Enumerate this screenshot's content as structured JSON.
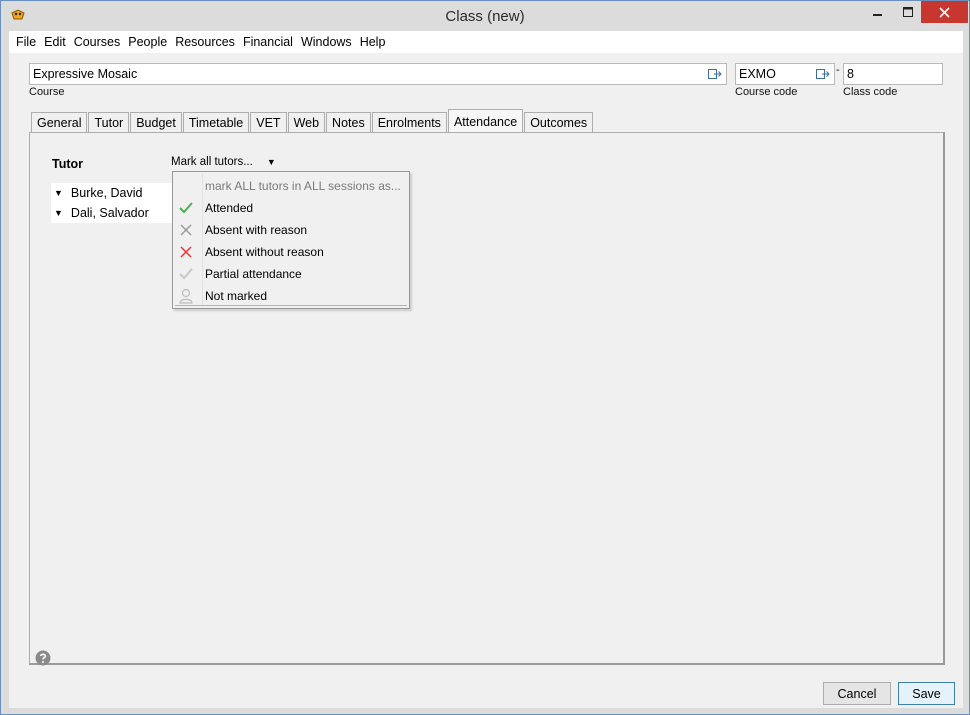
{
  "window": {
    "title": "Class (new)",
    "accent_close": "#c7372f"
  },
  "menu": [
    "File",
    "Edit",
    "Courses",
    "People",
    "Resources",
    "Financial",
    "Windows",
    "Help"
  ],
  "course": {
    "value": "Expressive Mosaic",
    "label": "Course"
  },
  "course_code": {
    "value": "EXMO",
    "label": "Course code"
  },
  "separator": "-",
  "class_code": {
    "value": "8",
    "label": "Class code"
  },
  "tabs": [
    "General",
    "Tutor",
    "Budget",
    "Timetable",
    "VET",
    "Web",
    "Notes",
    "Enrolments",
    "Attendance",
    "Outcomes"
  ],
  "active_tab": "Attendance",
  "attendance": {
    "heading": "Tutor",
    "mark_all_label": "Mark all tutors...",
    "tutors": [
      "Burke, David",
      "Dali, Salvador"
    ],
    "dropdown": {
      "header": "mark ALL tutors in ALL sessions as...",
      "items": [
        {
          "label": "Attended",
          "icon": "check-icon",
          "color": "#4caf50"
        },
        {
          "label": "Absent with reason",
          "icon": "cross-icon",
          "color": "#9a9a9a"
        },
        {
          "label": "Absent without reason",
          "icon": "cross-icon",
          "color": "#e53935"
        },
        {
          "label": "Partial attendance",
          "icon": "check-icon",
          "color": "#c8c8c8"
        },
        {
          "label": "Not marked",
          "icon": "person-icon",
          "color": "#bdbdbd"
        }
      ]
    }
  },
  "buttons": {
    "cancel": "Cancel",
    "save": "Save"
  }
}
